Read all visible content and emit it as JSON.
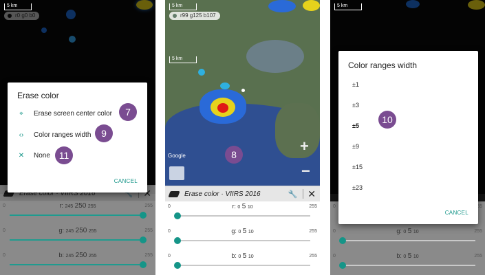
{
  "scale_label": "5 km",
  "panel1": {
    "coord_text": "r0 g0 b0",
    "dialog": {
      "title": "Erase color",
      "items": [
        {
          "icon": "crosshair-icon",
          "glyph": "⌖",
          "label": "Erase screen center color"
        },
        {
          "icon": "code-brackets-icon",
          "glyph": "‹›",
          "label": "Color ranges width"
        },
        {
          "icon": "close-icon",
          "glyph": "✕",
          "label": "None"
        }
      ],
      "cancel": "CANCEL"
    },
    "toolbar_title": "Erase color · VIIRS 2016",
    "sliders": [
      {
        "channel": "r:",
        "low": "245",
        "value": "250",
        "high": "255",
        "min": "0",
        "max": "255",
        "fraction": 0.98
      },
      {
        "channel": "g:",
        "low": "245",
        "value": "250",
        "high": "255",
        "min": "0",
        "max": "255",
        "fraction": 0.98
      },
      {
        "channel": "b:",
        "low": "245",
        "value": "250",
        "high": "255",
        "min": "0",
        "max": "255",
        "fraction": 0.98
      }
    ],
    "callouts": [
      "7",
      "9",
      "11"
    ]
  },
  "panel2": {
    "coord_text": "r99 g125 b107",
    "google": "Google",
    "toolbar_title": "Erase color · VIIRS 2016",
    "sliders": [
      {
        "channel": "r:",
        "low": "0",
        "value": "5",
        "high": "10",
        "min": "0",
        "max": "255",
        "fraction": 0.02
      },
      {
        "channel": "g:",
        "low": "0",
        "value": "5",
        "high": "10",
        "min": "0",
        "max": "255",
        "fraction": 0.02
      },
      {
        "channel": "b:",
        "low": "0",
        "value": "5",
        "high": "10",
        "min": "0",
        "max": "255",
        "fraction": 0.02
      }
    ],
    "callout": "8"
  },
  "panel3": {
    "dialog": {
      "title": "Color ranges width",
      "options": [
        "±1",
        "±3",
        "±5",
        "±9",
        "±15",
        "±23"
      ],
      "selected": "±5",
      "cancel": "CANCEL"
    },
    "sliders": [
      {
        "channel": "r:",
        "low": "0",
        "value": "5",
        "high": "10",
        "min": "0",
        "max": "255",
        "fraction": 0.02
      },
      {
        "channel": "g:",
        "low": "0",
        "value": "5",
        "high": "10",
        "min": "0",
        "max": "255",
        "fraction": 0.02
      },
      {
        "channel": "b:",
        "low": "0",
        "value": "5",
        "high": "10",
        "min": "0",
        "max": "255",
        "fraction": 0.02
      }
    ],
    "callout": "10"
  },
  "colors": {
    "accent": "#159588",
    "callout": "#7a4c91"
  }
}
